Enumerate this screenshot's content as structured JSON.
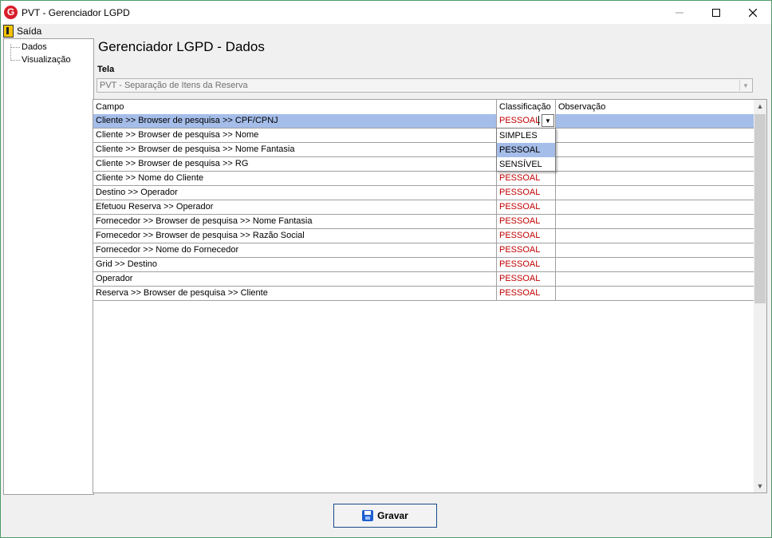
{
  "window": {
    "title": "PVT - Gerenciador LGPD",
    "app_icon_letter": "G"
  },
  "menu": {
    "exit_label": "Saída"
  },
  "tree": {
    "items": [
      {
        "label": "Dados"
      },
      {
        "label": "Visualização"
      }
    ]
  },
  "page": {
    "title": "Gerenciador LGPD - Dados",
    "tela_label": "Tela",
    "tela_value": "PVT - Separação de Itens da Reserva"
  },
  "grid": {
    "headers": [
      "Campo",
      "Classificação",
      "Observação"
    ],
    "rows": [
      {
        "campo": "Cliente >> Browser de pesquisa >> CPF/CPNJ",
        "classificacao": "PESSOAL",
        "observacao": ""
      },
      {
        "campo": "Cliente >> Browser de pesquisa >> Nome",
        "classificacao": "",
        "observacao": ""
      },
      {
        "campo": "Cliente >> Browser de pesquisa >> Nome Fantasia",
        "classificacao": "",
        "observacao": ""
      },
      {
        "campo": "Cliente >> Browser de pesquisa >> RG",
        "classificacao": "",
        "observacao": ""
      },
      {
        "campo": "Cliente >> Nome do Cliente",
        "classificacao": "PESSOAL",
        "observacao": ""
      },
      {
        "campo": "Destino >> Operador",
        "classificacao": "PESSOAL",
        "observacao": ""
      },
      {
        "campo": "Efetuou Reserva >> Operador",
        "classificacao": "PESSOAL",
        "observacao": ""
      },
      {
        "campo": "Fornecedor >> Browser de pesquisa >> Nome Fantasia",
        "classificacao": "PESSOAL",
        "observacao": ""
      },
      {
        "campo": "Fornecedor >> Browser de pesquisa >> Razão Social",
        "classificacao": "PESSOAL",
        "observacao": ""
      },
      {
        "campo": "Fornecedor >> Nome do Fornecedor",
        "classificacao": "PESSOAL",
        "observacao": ""
      },
      {
        "campo": "Grid >> Destino",
        "classificacao": "PESSOAL",
        "observacao": ""
      },
      {
        "campo": "Operador",
        "classificacao": "PESSOAL",
        "observacao": ""
      },
      {
        "campo": "Reserva >> Browser de pesquisa >> Cliente",
        "classificacao": "PESSOAL",
        "observacao": ""
      }
    ]
  },
  "dropdown": {
    "options": [
      "SIMPLES",
      "PESSOAL",
      "SENSÍVEL"
    ],
    "selected": "PESSOAL"
  },
  "footer": {
    "save_label": "Gravar"
  },
  "colors": {
    "selection": "#a5bde9",
    "classification_text": "#c00000",
    "window_border": "#4f9a6a"
  }
}
